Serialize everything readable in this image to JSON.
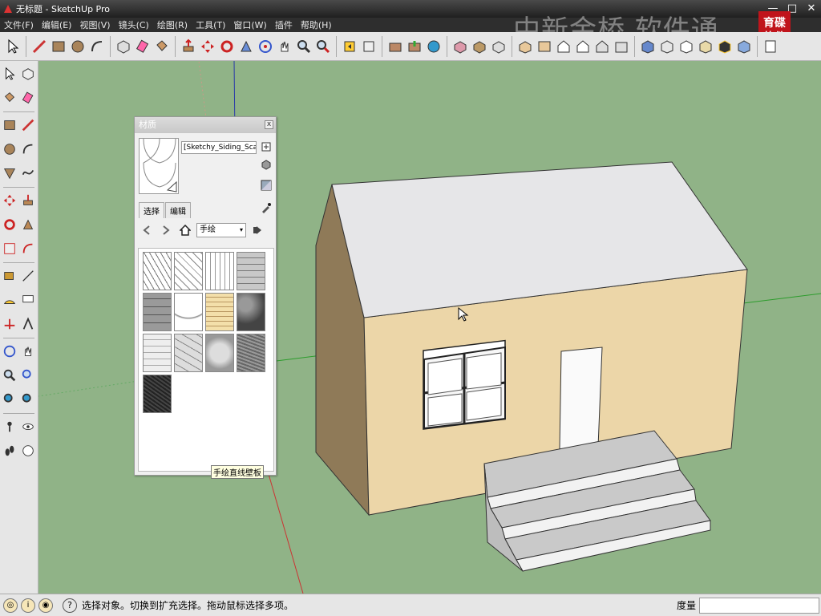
{
  "window": {
    "title": "无标题 - SketchUp Pro",
    "controls": [
      "—",
      "□",
      "✕"
    ]
  },
  "menu": [
    "文件(F)",
    "编辑(E)",
    "视图(V)",
    "镜头(C)",
    "绘图(R)",
    "工具(T)",
    "窗口(W)",
    "插件",
    "帮助(H)"
  ],
  "watermark": "中新金桥  软件通",
  "brand_logo": "育碟\n软件",
  "materials_panel": {
    "title": "材质",
    "material_name": "[Sketchy_Siding_Scale]1",
    "tabs": [
      "选择",
      "编辑"
    ],
    "active_tab": "选择",
    "collection": "手绘",
    "tooltip": "手绘直线壁板",
    "swatches": [
      "diagonal-lines",
      "crosshatch",
      "vertical-grain",
      "gray-siding",
      "stone-blocks",
      "scallop-shingles",
      "wood-siding",
      "rubble-stone",
      "brick-light",
      "flagstone",
      "cobble",
      "gray-noise",
      "dark-stone"
    ]
  },
  "status": {
    "text": "选择对象。切换到扩充选择。拖动鼠标选择多项。",
    "measure_label": "度量",
    "measure_value": ""
  },
  "colors": {
    "viewport_bg": "#90b387",
    "wall_front": "#ecd6a8",
    "wall_side": "#8f7a58",
    "roof": "#e6e6e8"
  }
}
